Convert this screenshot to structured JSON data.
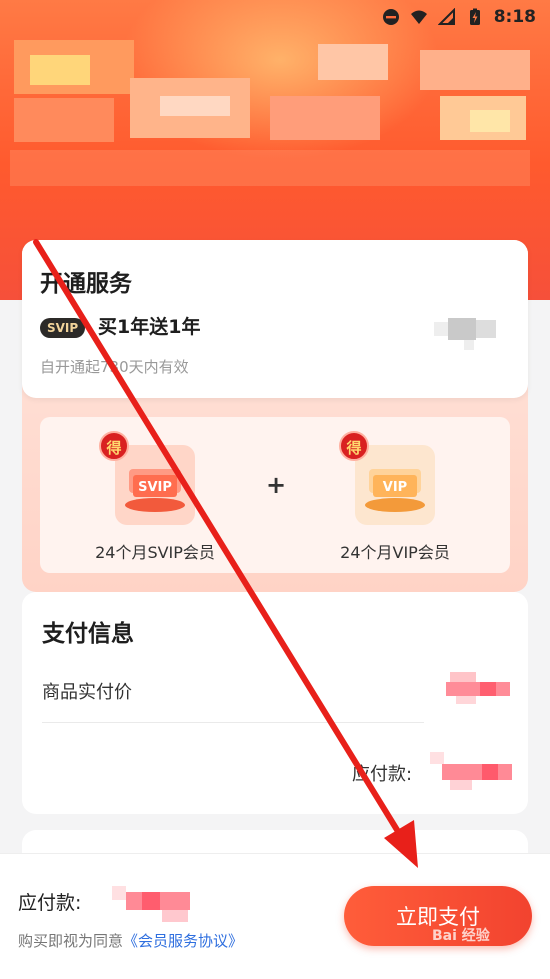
{
  "status_bar": {
    "time": "8:18"
  },
  "service": {
    "title": "开通服务",
    "badge": "SVIP",
    "plan": "买1年送1年",
    "validity": "自开通起730天内有效"
  },
  "benefits": {
    "badge_char": "得",
    "plus": "+",
    "items": [
      {
        "tile_text": "SVIP",
        "label": "24个月SVIP会员"
      },
      {
        "tile_text": "VIP",
        "label": "24个月VIP会员"
      }
    ]
  },
  "payment_info": {
    "title": "支付信息",
    "actual_price_label": "商品实付价",
    "due_label": "应付款:"
  },
  "bottom_bar": {
    "due_label": "应付款:",
    "agree_prefix": "购买即视为同意",
    "agree_link": "《会员服务协议》",
    "pay_button": "立即支付"
  },
  "watermark": "Bai 经验",
  "colors": {
    "accent": "#f2432f",
    "header": "#ff5a2e",
    "link": "#2f6fdf",
    "annotation_arrow": "#e8201a"
  }
}
